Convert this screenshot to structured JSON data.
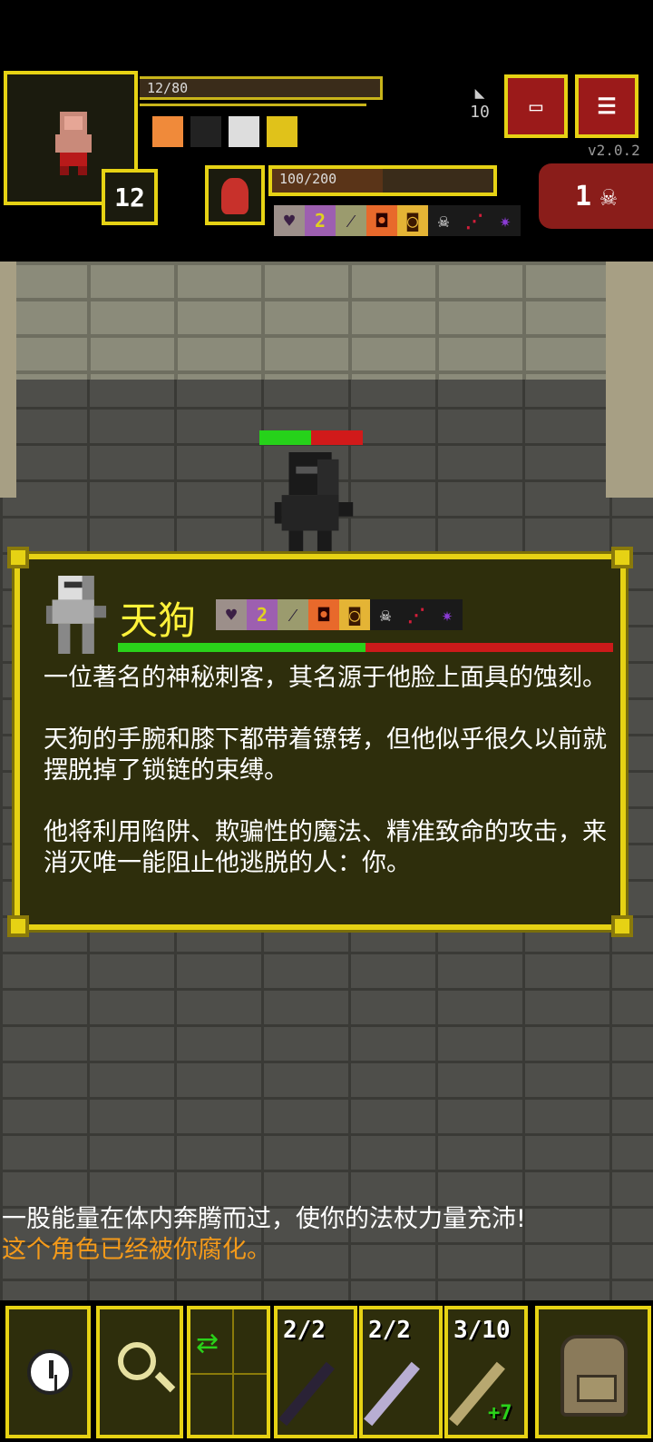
{
  "hud": {
    "hp_text": "12/80",
    "level": "12",
    "depth": "10",
    "version": "v2.0.2",
    "journal_icon": "journal-icon",
    "menu_icon": "menu-icon",
    "boss_hp_text": "100/200",
    "boss_hp_fraction": 0.5,
    "kill_count": "1",
    "buffs": [
      "bless-buff-icon",
      "armor-buff-icon",
      "key-buff-icon",
      "chest-buff-icon"
    ],
    "boss_champion_icons": [
      {
        "glyph": "♥",
        "name": "heart-affix-icon"
      },
      {
        "glyph": "2",
        "name": "rank2-affix-icon"
      },
      {
        "glyph": "⁄",
        "name": "slash-affix-icon"
      },
      {
        "glyph": "◘",
        "name": "target-affix-icon"
      },
      {
        "glyph": "◙",
        "name": "box-affix-icon"
      },
      {
        "glyph": "☠",
        "name": "skull-affix-icon"
      },
      {
        "glyph": "⋰",
        "name": "blood-affix-icon"
      },
      {
        "glyph": "✷",
        "name": "void-affix-icon"
      }
    ]
  },
  "enemy": {
    "hp_fraction": 0.5
  },
  "info": {
    "name": "天狗",
    "hp_fraction": 0.5,
    "desc_p1": "一位著名的神秘刺客，其名源于他脸上面具的蚀刻。",
    "desc_p2": "天狗的手腕和膝下都带着镣铐，但他似乎很久以前就摆脱掉了锁链的束缚。",
    "desc_p3": "他将利用陷阱、欺骗性的魔法、精准致命的攻击，来消灭唯一能阻止他逃脱的人：你。"
  },
  "log": {
    "line1": "一股能量在体内奔腾而过，使你的法杖力量充沛!",
    "line2": "这个角色已经被你腐化。"
  },
  "toolbar": {
    "qs1_count": "2/2",
    "qs2_count": "2/2",
    "qs3_count": "3/10",
    "qs3_bonus": "+7"
  },
  "colors": {
    "frame": "#e6d214",
    "panel": "#2e2e0c",
    "name": "#fff23a",
    "log_warning": "#f49a1a",
    "health": "#2ad21a",
    "damage": "#cc1a1a"
  }
}
